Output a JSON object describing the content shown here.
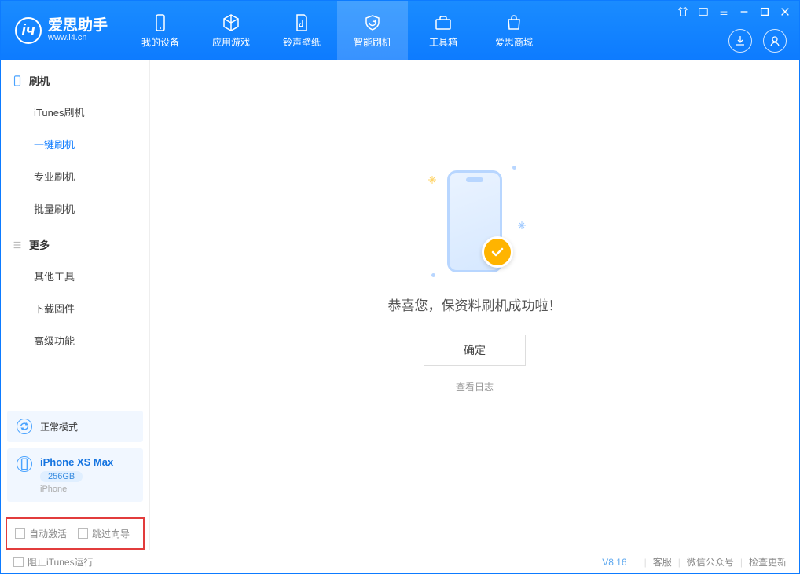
{
  "app": {
    "name": "爱思助手",
    "url": "www.i4.cn"
  },
  "nav": {
    "items": [
      {
        "label": "我的设备"
      },
      {
        "label": "应用游戏"
      },
      {
        "label": "铃声壁纸"
      },
      {
        "label": "智能刷机"
      },
      {
        "label": "工具箱"
      },
      {
        "label": "爱思商城"
      }
    ]
  },
  "sidebar": {
    "section1": {
      "title": "刷机"
    },
    "items1": [
      {
        "label": "iTunes刷机"
      },
      {
        "label": "一键刷机"
      },
      {
        "label": "专业刷机"
      },
      {
        "label": "批量刷机"
      }
    ],
    "section2": {
      "title": "更多"
    },
    "items2": [
      {
        "label": "其他工具"
      },
      {
        "label": "下载固件"
      },
      {
        "label": "高级功能"
      }
    ],
    "mode_label": "正常模式",
    "device": {
      "name": "iPhone XS Max",
      "capacity": "256GB",
      "type": "iPhone"
    },
    "cb1": "自动激活",
    "cb2": "跳过向导"
  },
  "main": {
    "success": "恭喜您，保资料刷机成功啦！",
    "ok": "确定",
    "view_log": "查看日志"
  },
  "status": {
    "block_itunes": "阻止iTunes运行",
    "version": "V8.16",
    "links": [
      "客服",
      "微信公众号",
      "检查更新"
    ]
  }
}
